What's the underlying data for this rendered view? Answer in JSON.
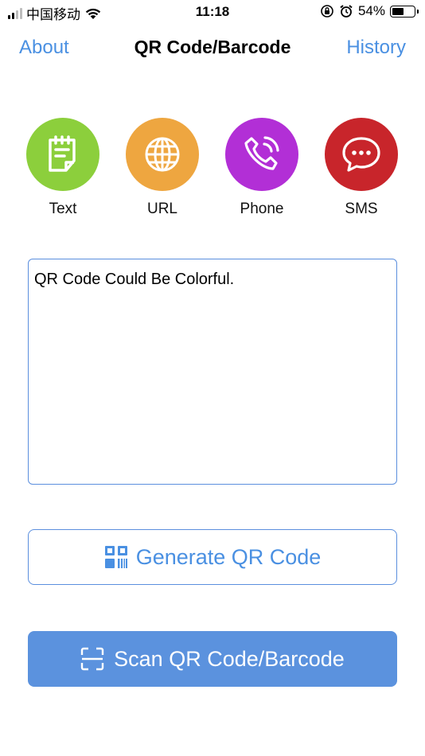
{
  "status_bar": {
    "carrier": "中国移动",
    "time": "11:18",
    "battery_percent": "54%",
    "battery_level": 0.54,
    "icons": [
      "signal-icon",
      "wifi-icon",
      "orientation-lock-icon",
      "alarm-icon",
      "battery-icon"
    ]
  },
  "nav": {
    "left": "About",
    "title": "QR Code/Barcode",
    "right": "History"
  },
  "categories": [
    {
      "label": "Text",
      "icon": "note-icon",
      "color": "#8ccf3c"
    },
    {
      "label": "URL",
      "icon": "globe-icon",
      "color": "#eea640"
    },
    {
      "label": "Phone",
      "icon": "phone-icon",
      "color": "#b22fd6"
    },
    {
      "label": "SMS",
      "icon": "chat-bubble-icon",
      "color": "#c8252b"
    }
  ],
  "input": {
    "value": "QR Code Could Be Colorful."
  },
  "buttons": {
    "generate": "Generate QR Code",
    "scan": "Scan QR Code/Barcode"
  },
  "colors": {
    "accent": "#4a90e2",
    "scan_button": "#5b92de"
  }
}
